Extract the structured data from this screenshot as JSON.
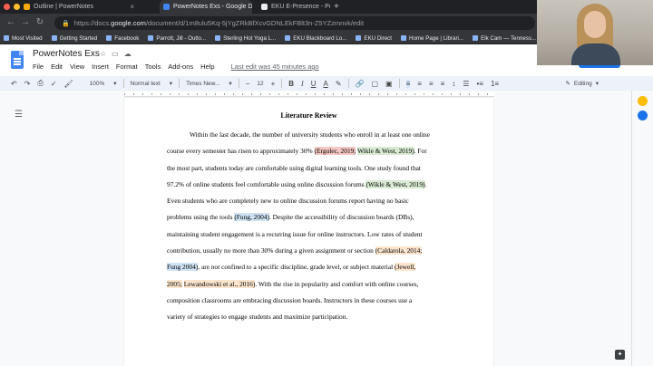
{
  "browser": {
    "tabs": [
      {
        "title": "Outline | PowerNotes",
        "active": false,
        "favicon_color": "#f9ab00"
      },
      {
        "title": "PowerNotes Exs - Google Docs",
        "active": true,
        "favicon_color": "#4285f4"
      },
      {
        "title": "EKU E-Presence - Powered By",
        "active": false,
        "favicon_color": "#e8eaed"
      }
    ],
    "address": {
      "prefix": "https://docs.",
      "host": "google.com",
      "path": "/document/d/1m8ulu5Kq-5jYgZRkBfXcvGDNLEkFBlt3n-Z5YZzmnvk/edit"
    },
    "bookmarks": [
      "Most Visited",
      "Getting Started",
      "Facebook",
      "Parrott, Jill - Outlo...",
      "Sterling Hot Yoga L...",
      "EKU Blackboard Lo...",
      "EKU Direct",
      "Home Page | Librari...",
      "Elk Cam — Tenness...",
      "247 Ba"
    ]
  },
  "docs": {
    "title": "PowerNotes Exs",
    "menu": [
      "File",
      "Edit",
      "View",
      "Insert",
      "Format",
      "Tools",
      "Add-ons",
      "Help"
    ],
    "last_edit": "Last edit was 45 minutes ago",
    "toolbar": {
      "zoom": "100%",
      "style": "Normal text",
      "font": "Times New...",
      "size": "12",
      "bold": "B",
      "italic": "I",
      "underline": "U",
      "text_color": "A",
      "mode": "Editing"
    }
  },
  "document": {
    "heading": "Literature Review",
    "lines": [
      [
        {
          "t": "Within the last decade, the number of university students who enroll in at least one online"
        }
      ],
      [
        {
          "t": "course every semester has risen to approximately 30% "
        },
        {
          "t": "(Ergulec, 2019;",
          "h": "red"
        },
        {
          "t": " "
        },
        {
          "t": "Wikle & West, 2019)",
          "h": "green"
        },
        {
          "t": ". For"
        }
      ],
      [
        {
          "t": "the most part, students today are comfortable using digital learning tools. One study found that"
        }
      ],
      [
        {
          "t": "97.2% of online students feel comfortable using online discussion forums "
        },
        {
          "t": "(Wikle & West, 2019)",
          "h": "green"
        },
        {
          "t": "."
        }
      ],
      [
        {
          "t": "Even students who are completely new to online discussion forums report having no basic"
        }
      ],
      [
        {
          "t": "problems using the tools "
        },
        {
          "t": "(Fung, 2004)",
          "h": "blue"
        },
        {
          "t": ". Despite the accessibility of discussion boards (DBs),"
        }
      ],
      [
        {
          "t": "maintaining student engagement is a recurring issue for online instructors. Low rates of student"
        }
      ],
      [
        {
          "t": "contribution, usually no more than 30% during a given assignment or section "
        },
        {
          "t": "(Caldarola, 2014;",
          "h": "orange"
        }
      ],
      [
        {
          "t": "Fung 2004)",
          "h": "blue"
        },
        {
          "t": ", are not confined to a specific discipline, grade level, or subject material "
        },
        {
          "t": "(Jewell,",
          "h": "orange"
        }
      ],
      [
        {
          "t": "2005;",
          "h": "orange"
        },
        {
          "t": " "
        },
        {
          "t": "Lewandowski et al., 2016)",
          "h": "orange"
        },
        {
          "t": ". With the rise in popularity and comfort with online courses,"
        }
      ],
      [
        {
          "t": "composition classrooms are embracing discussion boards. Instructors in these courses use a"
        }
      ],
      [
        {
          "t": "variety of strategies to engage students and maximize participation."
        }
      ]
    ]
  }
}
